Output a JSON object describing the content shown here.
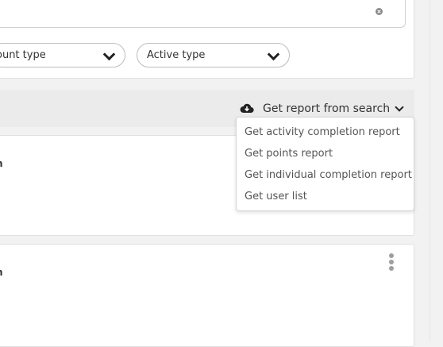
{
  "filters": {
    "account_type_label": "ount type",
    "active_type_label": "Active type"
  },
  "report": {
    "button_label": "Get report from search",
    "menu": [
      "Get activity completion report",
      "Get points report",
      "Get individual completion report",
      "Get user list"
    ]
  },
  "list": {
    "item1_fragment": "n",
    "item2_fragment": "n"
  },
  "icons": {
    "clear": "clear-icon",
    "cloud": "cloud-download-icon",
    "chevron": "chevron-down-icon",
    "kebab": "more-vertical-icon"
  }
}
